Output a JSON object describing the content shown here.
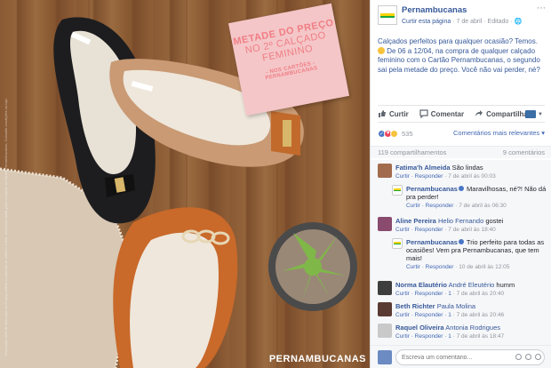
{
  "photo": {
    "promo": {
      "line1": "METADE DO PREÇO",
      "line2": "NO 2º CALÇADO",
      "line3": "FEMININO",
      "line4": "- NOS CARTÕES -",
      "line5": "PERNAMBUCANAS"
    },
    "shoe_brand": "VIAIA",
    "watermark": "PERNAMBUCANAS",
    "disclaimer": "Promoção 50% de desconto na 2ª peça válida no período de 06/04 a 12/04. Desconto válido para compras no Cartão Pernambucanas. Consulte condições na loja."
  },
  "post": {
    "page_name": "Pernambucanas",
    "follow_link": "Curtir esta página",
    "date": "7 de abril",
    "edited": "Editado",
    "text_before_emoji": "Calçados perfeitos para qualquer ocasião? Temos.",
    "text_after_emoji": "De 06 a 12/04, na compra de qualquer calçado feminino com o Cartão Pernambucanas, o segundo sai pela metade do preço. Você não vai perder, né?",
    "actions": {
      "like": "Curtir",
      "comment": "Comentar",
      "share": "Compartilhar"
    },
    "reaction_count": "535",
    "sort_label": "Comentários mais relevantes",
    "shares": "119 compartilhamentos",
    "comments_count": "9 comentários",
    "colors": {
      "link": "#365899",
      "like": "#4a76c5",
      "love": "#f0465c",
      "wow": "#f7c33c"
    }
  },
  "comments": [
    {
      "name": "Fatima'h Almeida",
      "text": "São lindas",
      "meta_links": "Curtir · Responder",
      "time": "7 de abril às 00:03"
    },
    {
      "name": "Pernambucanas",
      "text": "Maravilhosas, né?! Não dá pra perder!",
      "meta_links": "Curtir · Responder",
      "time": "7 de abril às 06:30",
      "reply": true
    },
    {
      "name": "Aline Pereira",
      "tag": "Helio Fernando",
      "text": "gostei",
      "meta_links": "Curtir · Responder",
      "time": "7 de abril às 18:40"
    },
    {
      "name": "Pernambucanas",
      "text": "Trio perfeito para todas as ocasiões! Vem pra Pernambucanas, que tem mais!",
      "meta_links": "Curtir · Responder",
      "time": "10 de abril às 12:05",
      "reply": true
    },
    {
      "name": "Norma Elautério",
      "tag": "André Eleutério",
      "text": "humm",
      "meta_links": "Curtir · Responder · 1",
      "time": "7 de abril às 20:40"
    },
    {
      "name": "Beth Richter",
      "tag": "Paula Molina",
      "text": "",
      "meta_links": "Curtir · Responder · 1",
      "time": "7 de abril às 20:46"
    },
    {
      "name": "Raquel Oliveira",
      "tag": "Antonia Rodrigues",
      "text": "",
      "meta_links": "Curtir · Responder · 1",
      "time": "7 de abril às 18:47"
    }
  ],
  "comment_input": {
    "placeholder": "Escreva um comentário..."
  }
}
